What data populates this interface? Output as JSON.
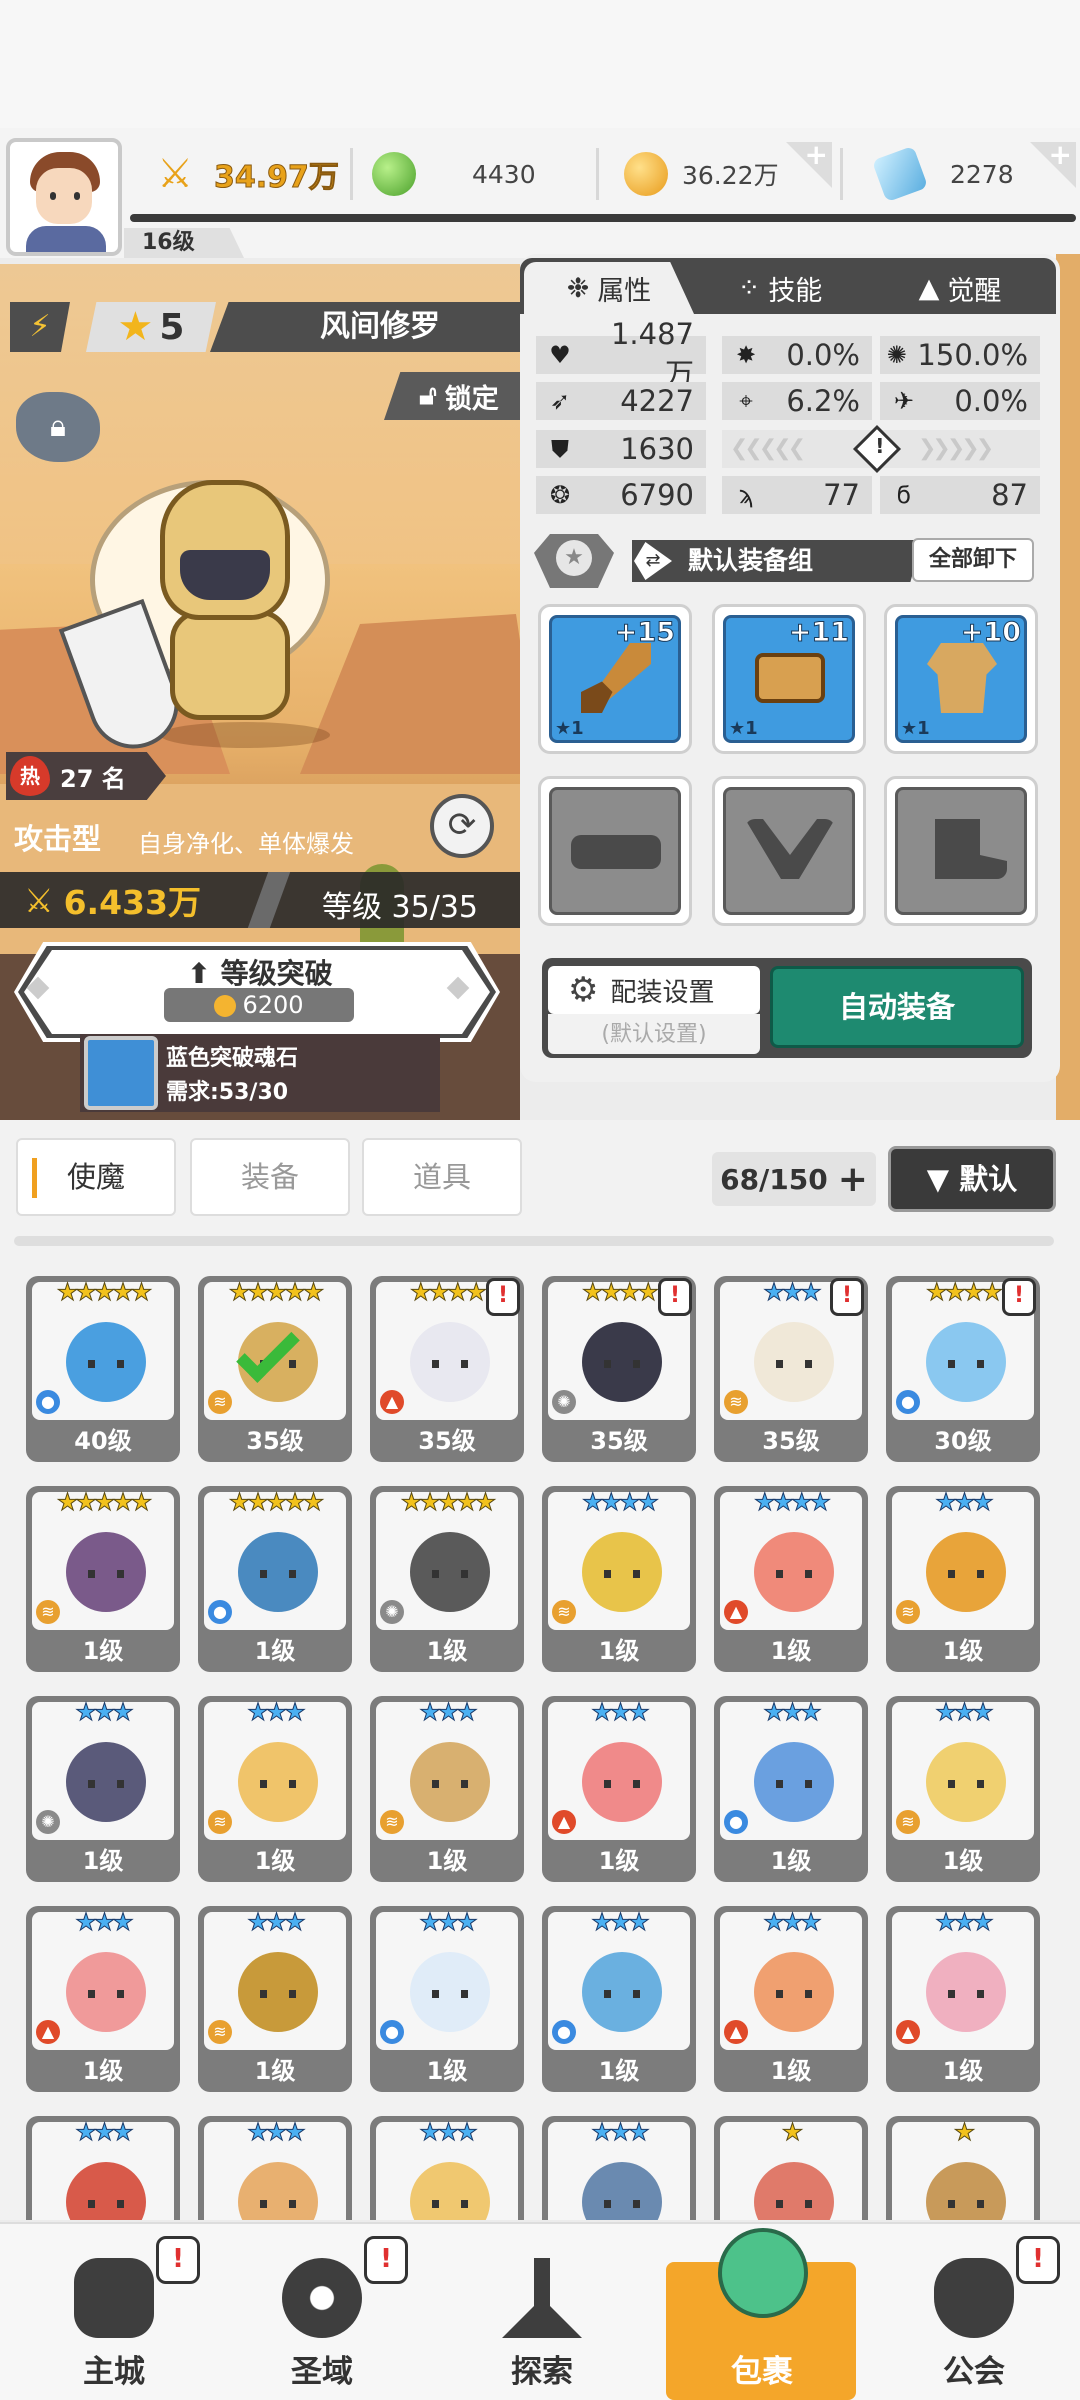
{
  "header": {
    "player_level": "16级",
    "power": "34.97万",
    "gems_green": "4430",
    "gold": "36.22万",
    "diamonds": "2278",
    "colors": {
      "green": "#5dbb3a",
      "gold": "#f4b430",
      "diamond": "#7cc6ee"
    },
    "icons": [
      "avatar",
      "sword-power-icon",
      "green-gem-icon",
      "gold-coin-icon",
      "diamond-icon",
      "plus-icon"
    ]
  },
  "hero": {
    "stars": "5",
    "name": "风间修罗",
    "lock_label": "锁定",
    "hot_rank": "27 名",
    "hot_icon": "热",
    "type": "攻击型",
    "type_desc": "自身净化、单体爆发",
    "power": "6.433万",
    "level": "等级 35/35",
    "breakthrough_label": "等级突破",
    "breakthrough_cost": "6200",
    "soulstone_name": "蓝色突破魂石",
    "soulstone_req": "需求:53/30"
  },
  "panel": {
    "tabs": [
      "属性",
      "技能",
      "觉醒"
    ],
    "stats": {
      "hp": "1.487万",
      "crit": "0.0%",
      "crit_dmg": "150.0%",
      "atk": "4227",
      "hit": "6.2%",
      "dodge": "0.0%",
      "def": "1630",
      "speed": "6790",
      "skill_a": "77",
      "skill_b": "87"
    },
    "equip_set_label": "默认装备组",
    "unequip_all": "全部卸下",
    "equipment": [
      {
        "plus": "+15",
        "star": "★1",
        "icon": "sword-icon"
      },
      {
        "plus": "+11",
        "star": "★1",
        "icon": "helmet-icon"
      },
      {
        "plus": "+10",
        "star": "★1",
        "icon": "armor-icon"
      },
      {
        "icon": "belt-empty-icon"
      },
      {
        "icon": "necklace-empty-icon"
      },
      {
        "icon": "boots-empty-icon"
      }
    ],
    "config_label": "配装设置",
    "config_sub": "(默认设置)",
    "auto_equip": "自动装备"
  },
  "inventory": {
    "tabs": [
      "使魔",
      "装备",
      "道具"
    ],
    "count": "68/150",
    "sort_label": "▼ 默认",
    "cards": [
      {
        "stars": "★★★★★",
        "level": "40级",
        "color": "#4a9fe0",
        "elem": "water"
      },
      {
        "stars": "★★★★★",
        "level": "35级",
        "color": "#d8b060",
        "elem": "wind",
        "checked": true
      },
      {
        "stars": "★★★★",
        "level": "35级",
        "color": "#e8e8f0",
        "elem": "fire",
        "alert": true
      },
      {
        "stars": "★★★★",
        "level": "35级",
        "color": "#3a3a4a",
        "elem": "light",
        "alert": true
      },
      {
        "stars": "★★★",
        "level": "35级",
        "color": "#f0e8d8",
        "elem": "wind",
        "alert": true,
        "blue": true
      },
      {
        "stars": "★★★★",
        "level": "30级",
        "color": "#8ac8f0",
        "elem": "water",
        "alert": true
      },
      {
        "stars": "★★★★★",
        "level": "1级",
        "color": "#7a5a8a",
        "elem": "wind"
      },
      {
        "stars": "★★★★★",
        "level": "1级",
        "color": "#4a8ac0",
        "elem": "water"
      },
      {
        "stars": "★★★★★",
        "level": "1级",
        "color": "#5a5a5a",
        "elem": "light"
      },
      {
        "stars": "★★★★",
        "level": "1级",
        "color": "#e8c44a",
        "elem": "wind",
        "blue": true
      },
      {
        "stars": "★★★★",
        "level": "1级",
        "color": "#f08a7a",
        "elem": "fire",
        "blue": true
      },
      {
        "stars": "★★★",
        "level": "1级",
        "color": "#e8a43a",
        "elem": "wind",
        "blue": true
      },
      {
        "stars": "★★★",
        "level": "1级",
        "color": "#5a5a7a",
        "elem": "light",
        "blue": true
      },
      {
        "stars": "★★★",
        "level": "1级",
        "color": "#f0c46a",
        "elem": "wind",
        "blue": true
      },
      {
        "stars": "★★★",
        "level": "1级",
        "color": "#d8b070",
        "elem": "wind",
        "blue": true
      },
      {
        "stars": "★★★",
        "level": "1级",
        "color": "#f08a8a",
        "elem": "fire",
        "blue": true
      },
      {
        "stars": "★★★",
        "level": "1级",
        "color": "#6aa0e0",
        "elem": "water",
        "blue": true
      },
      {
        "stars": "★★★",
        "level": "1级",
        "color": "#f0d070",
        "elem": "wind",
        "blue": true
      },
      {
        "stars": "★★★",
        "level": "1级",
        "color": "#f09a9a",
        "elem": "fire",
        "blue": true
      },
      {
        "stars": "★★★",
        "level": "1级",
        "color": "#c89a3a",
        "elem": "wind",
        "blue": true
      },
      {
        "stars": "★★★",
        "level": "1级",
        "color": "#e0ecf8",
        "elem": "water",
        "blue": true
      },
      {
        "stars": "★★★",
        "level": "1级",
        "color": "#6ab0e0",
        "elem": "water",
        "blue": true
      },
      {
        "stars": "★★★",
        "level": "1级",
        "color": "#f0a070",
        "elem": "fire",
        "blue": true
      },
      {
        "stars": "★★★",
        "level": "1级",
        "color": "#f0b0c0",
        "elem": "fire",
        "blue": true
      },
      {
        "stars": "★★★",
        "level": "",
        "color": "#d85a4a",
        "elem": "",
        "blue": true
      },
      {
        "stars": "★★★",
        "level": "",
        "color": "#e8b070",
        "elem": "",
        "blue": true
      },
      {
        "stars": "★★★",
        "level": "",
        "color": "#f0c870",
        "elem": "",
        "blue": true
      },
      {
        "stars": "★★★",
        "level": "",
        "color": "#6a8ab0",
        "elem": "",
        "blue": true
      },
      {
        "stars": "★",
        "level": "",
        "color": "#e07a6a",
        "elem": ""
      },
      {
        "stars": "★",
        "level": "",
        "color": "#c89a5a",
        "elem": ""
      }
    ]
  },
  "nav": {
    "items": [
      {
        "label": "主城",
        "alert": true
      },
      {
        "label": "圣域",
        "alert": true
      },
      {
        "label": "探索",
        "alert": false
      },
      {
        "label": "包裹",
        "alert": false,
        "active": true
      },
      {
        "label": "公会",
        "alert": true
      }
    ]
  }
}
